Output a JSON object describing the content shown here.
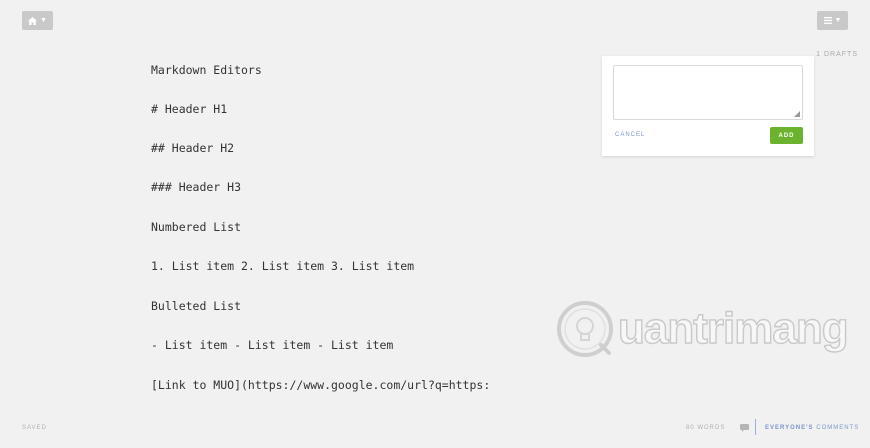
{
  "toolbar": {
    "home_icon": "home-icon",
    "menu_icon": "list-icon",
    "drafts_label": "1 DRAFTS"
  },
  "editor": {
    "lines": [
      "Markdown Editors",
      "# Header H1",
      "## Header H2",
      "### Header H3",
      "Numbered List",
      "1. List item 2. List item 3. List item",
      "Bulleted List",
      "- List item - List item - List item",
      "[Link to MUO](https://www.google.com/url?q=https:"
    ]
  },
  "comment_box": {
    "cancel_label": "CANCEL",
    "add_label": "ADD"
  },
  "watermark": {
    "text": "uantrimang"
  },
  "footer": {
    "status": "SAVED",
    "word_count": "80 WORDS",
    "comments_prefix": "EVERYONE'S",
    "comments_suffix": " COMMENTS"
  },
  "colors": {
    "background": "#f1f1f1",
    "add_button": "#6bb32e",
    "link_blue": "#7b96c9"
  }
}
